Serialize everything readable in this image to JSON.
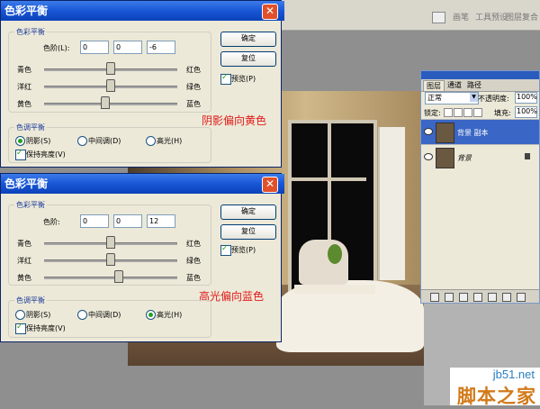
{
  "ps_toolbar": {
    "items": [
      "画笔",
      "工具预设",
      "图层复合"
    ]
  },
  "dialog1": {
    "title": "色彩平衡",
    "section": "色彩平衡",
    "levels_label": "色阶(L):",
    "levels": [
      "0",
      "0",
      "-6"
    ],
    "sliders": [
      {
        "left": "青色",
        "right": "红色",
        "value": 0
      },
      {
        "left": "洋红",
        "right": "绿色",
        "value": 0
      },
      {
        "left": "黄色",
        "right": "蓝色",
        "value": -6
      }
    ],
    "ok": "确定",
    "reset": "复位",
    "preview": "预览(P)",
    "preview_checked": true,
    "tone_section": "色调平衡",
    "tones": [
      "阴影(S)",
      "中间调(D)",
      "高光(H)"
    ],
    "tone_selected": 0,
    "preserve": "保持亮度(V)",
    "preserve_checked": true,
    "annotation": "阴影偏向黄色"
  },
  "dialog2": {
    "title": "色彩平衡",
    "section": "色彩平衡",
    "levels_label": "色阶:",
    "levels": [
      "0",
      "0",
      "12"
    ],
    "sliders": [
      {
        "left": "青色",
        "right": "红色",
        "value": 0
      },
      {
        "left": "洋红",
        "right": "绿色",
        "value": 0
      },
      {
        "left": "黄色",
        "right": "蓝色",
        "value": 12
      }
    ],
    "ok": "确定",
    "reset": "复位",
    "preview": "预览(P)",
    "preview_checked": true,
    "tone_section": "色调平衡",
    "tones": [
      "阴影(S)",
      "中间调(D)",
      "高光(H)"
    ],
    "tone_selected": 2,
    "preserve": "保持亮度(V)",
    "preserve_checked": true,
    "annotation": "高光偏向蓝色"
  },
  "layers": {
    "tabs": [
      "图层",
      "通道",
      "路径"
    ],
    "blend": "正常",
    "opacity_label": "不透明度:",
    "opacity": "100%",
    "lock_label": "锁定:",
    "fill_label": "填充:",
    "fill": "100%",
    "items": [
      {
        "name": "背景 副本",
        "selected": true
      },
      {
        "name": "背景",
        "selected": false
      }
    ]
  },
  "watermark": {
    "site": "jb51.net",
    "name": "脚本之家"
  }
}
